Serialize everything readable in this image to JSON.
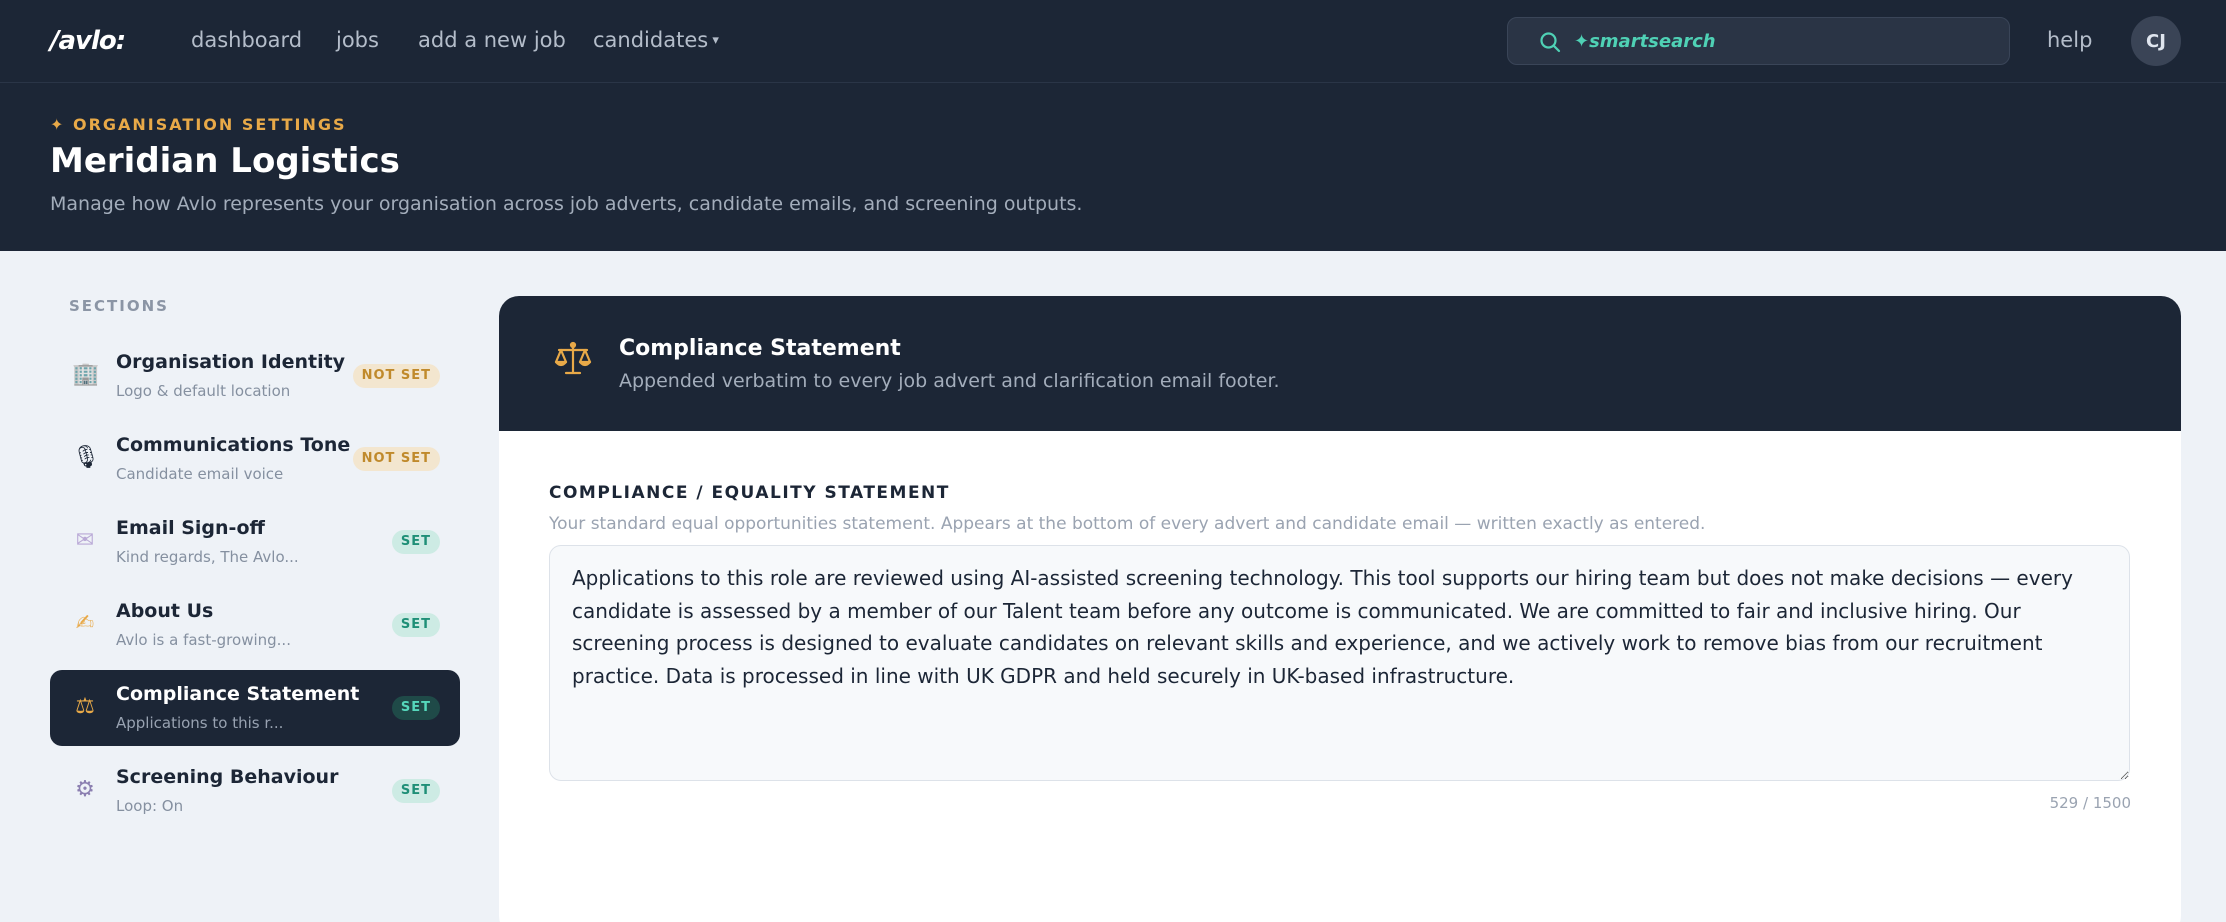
{
  "app": {
    "logo": "/avlo:",
    "nav": [
      "dashboard",
      "jobs",
      "add a new job",
      "candidates"
    ],
    "search_placeholder": "✦smartsearch",
    "help": "help",
    "avatar_initials": "CJ"
  },
  "header": {
    "eyebrow": "✦ ORGANISATION SETTINGS",
    "title": "Meridian Logistics",
    "subtitle": "Manage how Avlo represents your organisation across job adverts, candidate emails, and screening outputs."
  },
  "sidebar": {
    "label": "SECTIONS",
    "items": [
      {
        "title": "Organisation Identity",
        "sub": "Logo & default location",
        "badge": "NOT SET",
        "icon": "🏢"
      },
      {
        "title": "Communications Tone",
        "sub": "Candidate email voice",
        "badge": "NOT SET",
        "icon": "🎙"
      },
      {
        "title": "Email Sign-off",
        "sub": "Kind regards, The Avlo...",
        "badge": "SET",
        "icon": "✉"
      },
      {
        "title": "About Us",
        "sub": "Avlo is a fast-growing...",
        "badge": "SET",
        "icon": "✍"
      },
      {
        "title": "Compliance Statement",
        "sub": "Applications to this r...",
        "badge": "SET",
        "icon": "⚖"
      },
      {
        "title": "Screening Behaviour",
        "sub": "Loop: On",
        "badge": "SET",
        "icon": "⚙"
      }
    ]
  },
  "panel": {
    "title": "Compliance Statement",
    "subtitle": "Appended verbatim to every job advert and clarification email footer.",
    "field_label": "COMPLIANCE / EQUALITY STATEMENT",
    "field_help": "Your standard equal opportunities statement. Appears at the bottom of every advert and candidate email — written exactly as entered.",
    "statement": "Applications to this role are reviewed using AI-assisted screening technology. This tool supports our hiring team but does not make decisions — every candidate is assessed by a member of our Talent team before any outcome is communicated. We are committed to fair and inclusive hiring. Our screening process is designed to evaluate candidates on relevant skills and experience, and we actively work to remove bias from our recruitment practice. Data is processed in line with UK GDPR and held securely in UK-based infrastructure.",
    "counter": "529 / 1500"
  },
  "colors": {
    "navy": "#1c2636",
    "accent_teal": "#4fd1b5",
    "amber": "#e8a948"
  }
}
